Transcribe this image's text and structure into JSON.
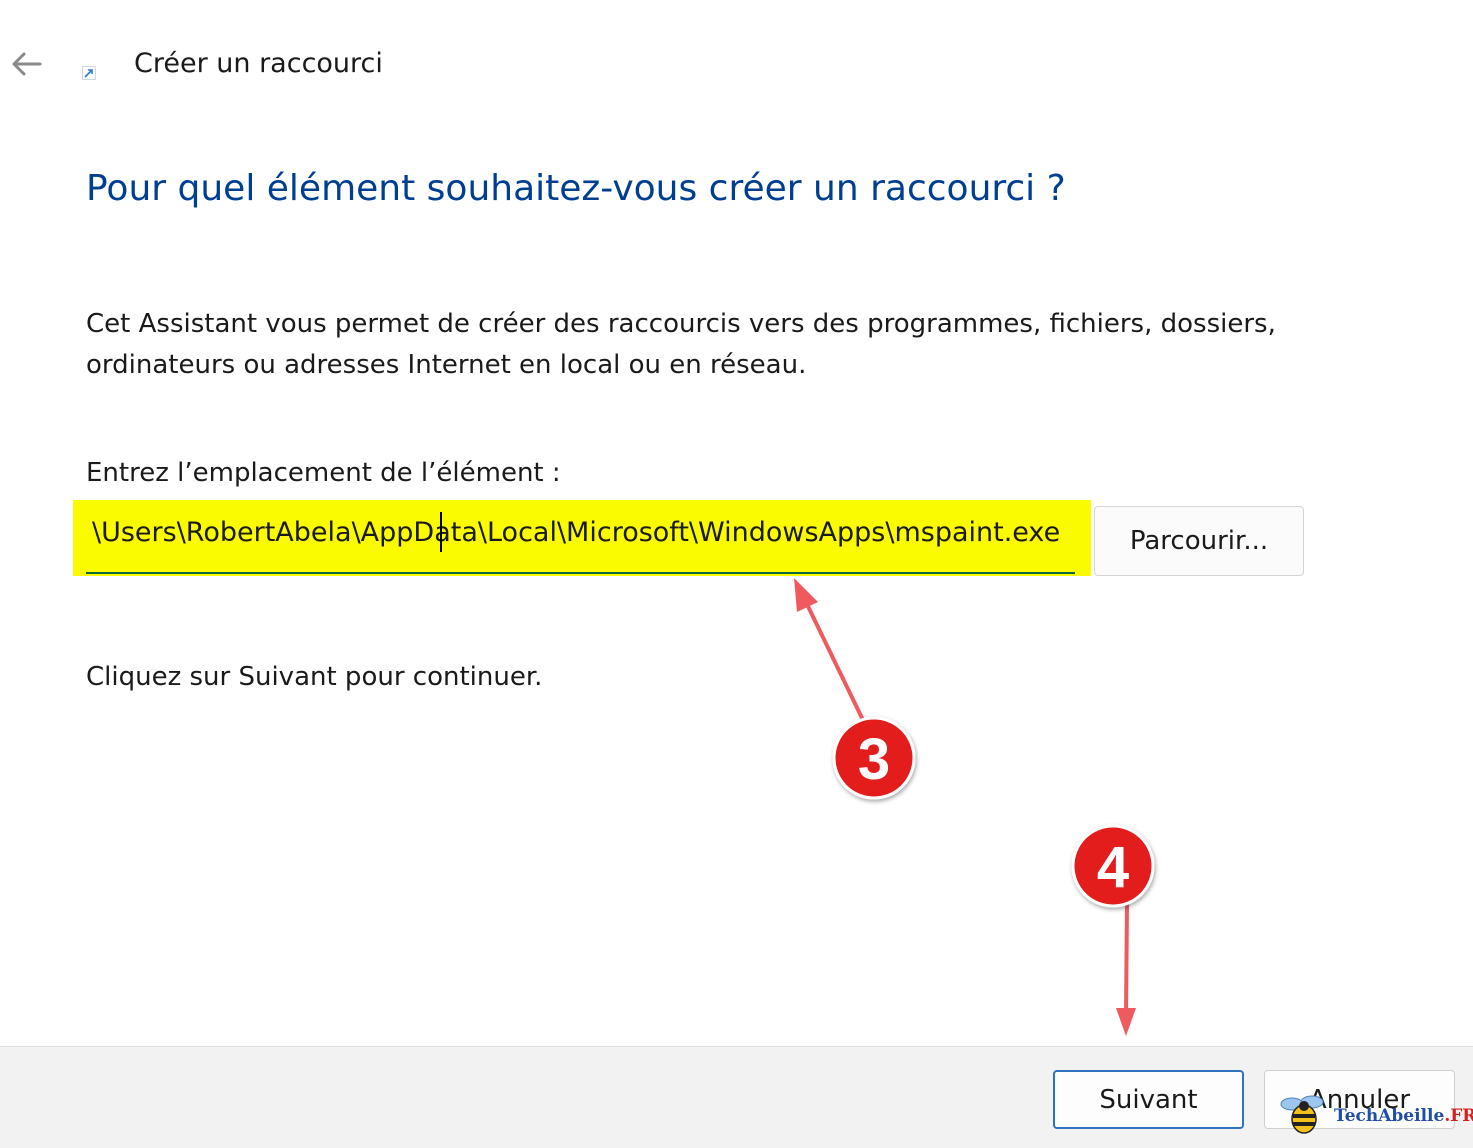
{
  "window": {
    "title": "Créer un raccourci"
  },
  "icons": {
    "back": "arrow-left-icon",
    "shortcut": "shortcut-arrow-icon"
  },
  "content": {
    "heading": "Pour quel élément souhaitez-vous créer un raccourci ?",
    "description": "Cet Assistant vous permet de créer des raccourcis vers des programmes, fichiers, dossiers, ordinateurs ou adresses Internet en local ou en réseau.",
    "location_label": "Entrez l’emplacement de l’élément :",
    "location_value": "\\Users\\RobertAbela\\AppData\\Local\\Microsoft\\WindowsApps\\mspaint.exe",
    "browse_label": "Parcourir...",
    "continue_text": "Cliquez sur Suivant pour continuer."
  },
  "footer": {
    "next_label": "Suivant",
    "cancel_label": "Annuler"
  },
  "annotations": [
    {
      "number": "3",
      "target": "location-input"
    },
    {
      "number": "4",
      "target": "next-button"
    }
  ],
  "watermark": {
    "brand": "TechAbeille",
    "suffix": ".FR"
  },
  "colors": {
    "heading": "#003e92",
    "highlight": "#fbfb00",
    "annotation_badge": "#e31c1c",
    "annotation_arrow": "#ef5a5f",
    "input_underline": "#0b6a3b",
    "primary_button_border": "#2f73c0"
  }
}
